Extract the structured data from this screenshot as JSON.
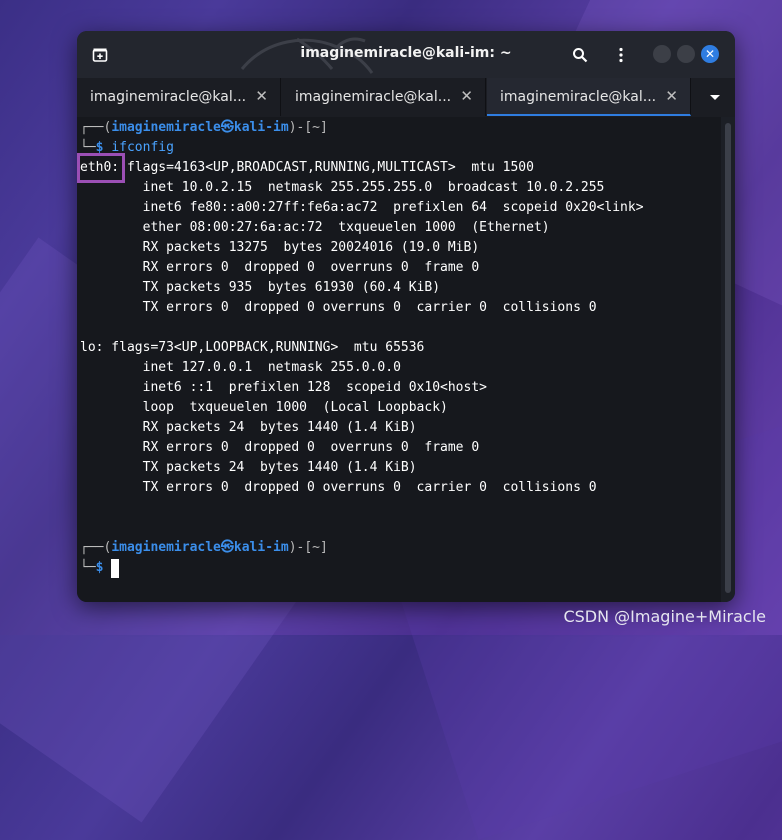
{
  "window": {
    "title": "imaginemiracle@kali-im: ~",
    "icons": [
      "new-tab-icon",
      "search-icon",
      "menu-icon",
      "minimize-icon",
      "maximize-icon",
      "close-icon"
    ],
    "close_glyph": "✕"
  },
  "tabs": [
    {
      "label": "imaginemiracle@kal...",
      "close": "✕",
      "active": false
    },
    {
      "label": "imaginemiracle@kal...",
      "close": "✕",
      "active": false
    },
    {
      "label": "imaginemiracle@kal...",
      "close": "✕",
      "active": true
    }
  ],
  "terminal": {
    "prompt1": {
      "corner": "┌──",
      "open": "(",
      "userhost": "imaginemiracle㉿kali-im",
      "close": ")",
      "dash": "-",
      "dir": "[~]"
    },
    "prompt1_bottom": "└─",
    "dollar": "$",
    "command": "ifconfig",
    "output": [
      "eth0: flags=4163<UP,BROADCAST,RUNNING,MULTICAST>  mtu 1500",
      "        inet 10.0.2.15  netmask 255.255.255.0  broadcast 10.0.2.255",
      "        inet6 fe80::a00:27ff:fe6a:ac72  prefixlen 64  scopeid 0x20<link>",
      "        ether 08:00:27:6a:ac:72  txqueuelen 1000  (Ethernet)",
      "        RX packets 13275  bytes 20024016 (19.0 MiB)",
      "        RX errors 0  dropped 0  overruns 0  frame 0",
      "        TX packets 935  bytes 61930 (60.4 KiB)",
      "        TX errors 0  dropped 0 overruns 0  carrier 0  collisions 0",
      "",
      "lo: flags=73<UP,LOOPBACK,RUNNING>  mtu 65536",
      "        inet 127.0.0.1  netmask 255.0.0.0",
      "        inet6 ::1  prefixlen 128  scopeid 0x10<host>",
      "        loop  txqueuelen 1000  (Local Loopback)",
      "        RX packets 24  bytes 1440 (1.4 KiB)",
      "        RX errors 0  dropped 0  overruns 0  frame 0",
      "        TX packets 24  bytes 1440 (1.4 KiB)",
      "        TX errors 0  dropped 0 overruns 0  carrier 0  collisions 0"
    ],
    "prompt2": {
      "corner": "┌──",
      "open": "(",
      "userhost": "imaginemiracle㉿kali-im",
      "close": ")",
      "dash": "-",
      "dir": "[~]"
    },
    "prompt2_bottom": "└─",
    "dollar2": "$"
  },
  "watermark": "CSDN @Imagine+Miracle",
  "colors": {
    "accent": "#2f7de1",
    "highlight": "#9b4fb5",
    "prompt": "#3b8eea"
  }
}
